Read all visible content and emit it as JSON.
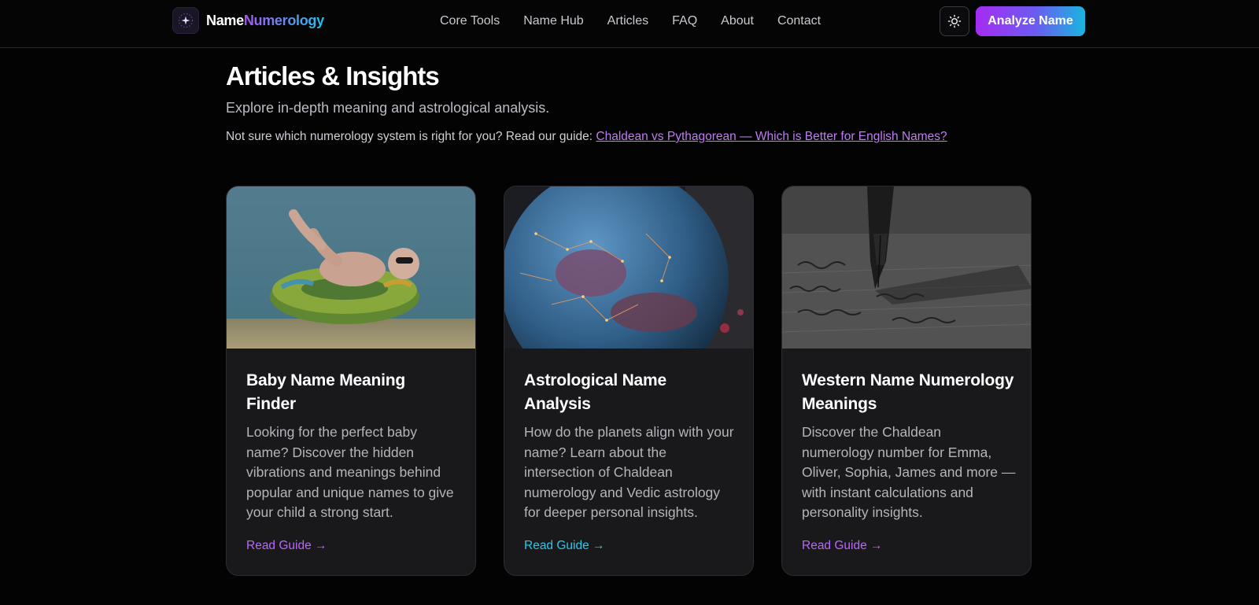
{
  "header": {
    "logo_part1": "Name",
    "logo_part2": "Numerology",
    "logo_icon": "sparkle-icon",
    "nav": [
      {
        "label": "Core Tools"
      },
      {
        "label": "Name Hub"
      },
      {
        "label": "Articles"
      },
      {
        "label": "FAQ"
      },
      {
        "label": "About"
      },
      {
        "label": "Contact"
      }
    ],
    "theme_icon": "sun-icon",
    "cta_label": "Analyze Name"
  },
  "intro": {
    "title": "Articles & Insights",
    "subtitle": "Explore in-depth meaning and astrological analysis.",
    "guide_prefix": "Not sure which numerology system is right for you? Read our guide: ",
    "guide_link": "Chaldean vs Pythagorean — Which is Better for English Names?"
  },
  "cards": [
    {
      "title": "Baby Name Meaning Finder",
      "description": "Looking for the perfect baby name? Discover the hidden vibrations and meanings behind popular and unique names to give your child a strong start.",
      "link": "Read Guide →",
      "image": "baby-on-float-photo"
    },
    {
      "title": "Astrological Name Analysis",
      "description": "How do the planets align with your name? Learn about the intersection of Chaldean numerology and Vedic astrology for deeper personal insights.",
      "link": "Read Guide →",
      "image": "celestial-globe-photo"
    },
    {
      "title": "Western Name Numerology Meanings",
      "description": "Discover the Chaldean numerology number for Emma, Oliver, Sophia, James and more — with instant calculations and personality insights.",
      "link": "Read Guide →",
      "image": "fountain-pen-writing-photo"
    }
  ],
  "colors": {
    "background": "#030303",
    "card": "#19191b",
    "accent_purple": "#b86af5",
    "accent_cyan": "#27c8ec"
  }
}
